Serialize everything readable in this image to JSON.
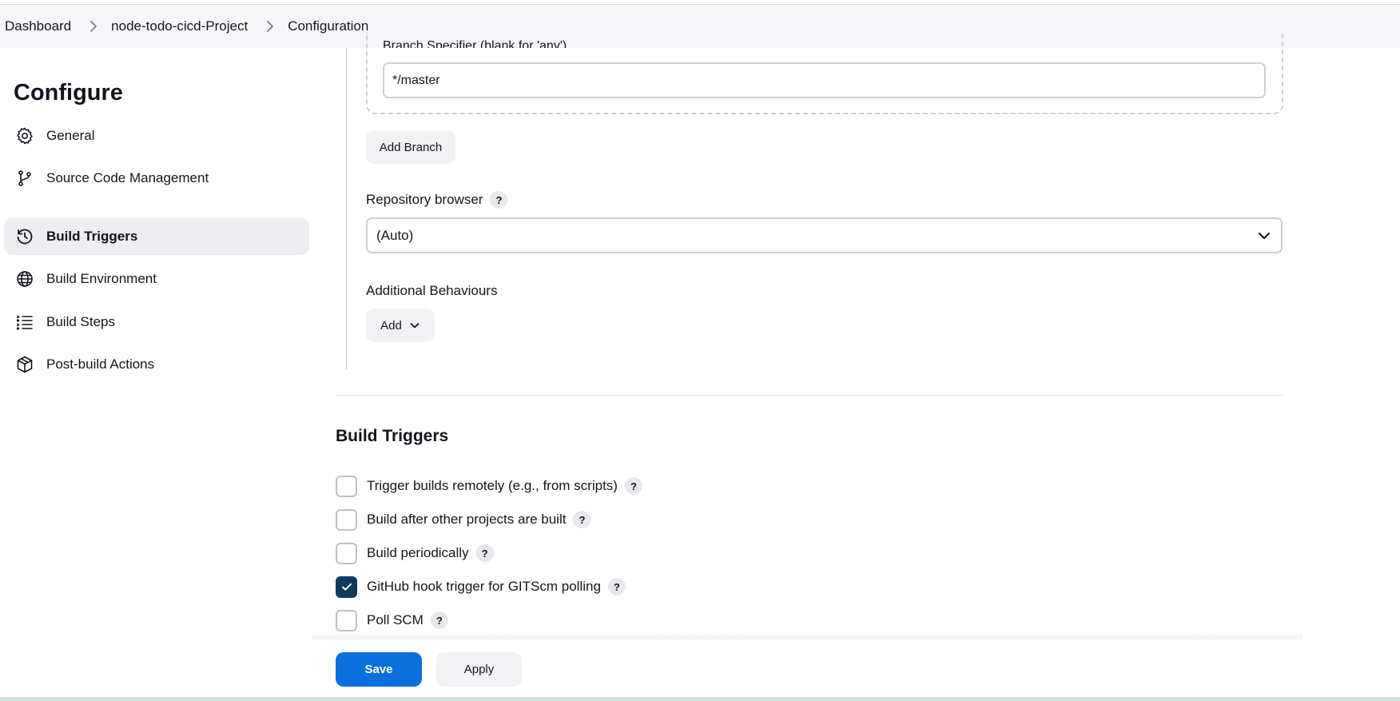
{
  "breadcrumb": {
    "items": [
      "Dashboard",
      "node-todo-cicd-Project",
      "Configuration"
    ]
  },
  "sidebar": {
    "title": "Configure",
    "items": [
      {
        "label": "General",
        "icon": "gear-icon"
      },
      {
        "label": "Source Code Management",
        "icon": "git-branch-icon"
      },
      {
        "label": "Build Triggers",
        "icon": "clock-icon",
        "active": true
      },
      {
        "label": "Build Environment",
        "icon": "globe-icon"
      },
      {
        "label": "Build Steps",
        "icon": "list-icon"
      },
      {
        "label": "Post-build Actions",
        "icon": "package-icon"
      }
    ]
  },
  "scm": {
    "branch_specifier_label": "Branch Specifier (blank for 'any')",
    "branch_specifier_value": "*/master",
    "add_branch_label": "Add Branch",
    "repo_browser_label": "Repository browser",
    "repo_browser_value": "(Auto)",
    "additional_behaviours_label": "Additional Behaviours",
    "add_label": "Add",
    "help_label": "?"
  },
  "build_triggers": {
    "title": "Build Triggers",
    "options": [
      {
        "label": "Trigger builds remotely (e.g., from scripts)",
        "checked": false
      },
      {
        "label": "Build after other projects are built",
        "checked": false
      },
      {
        "label": "Build periodically",
        "checked": false
      },
      {
        "label": "GitHub hook trigger for GITScm polling",
        "checked": true
      },
      {
        "label": "Poll SCM",
        "checked": false
      }
    ]
  },
  "footer": {
    "save_label": "Save",
    "apply_label": "Apply"
  },
  "colors": {
    "primary": "#0b6fde",
    "checked": "#0f3a5c"
  }
}
